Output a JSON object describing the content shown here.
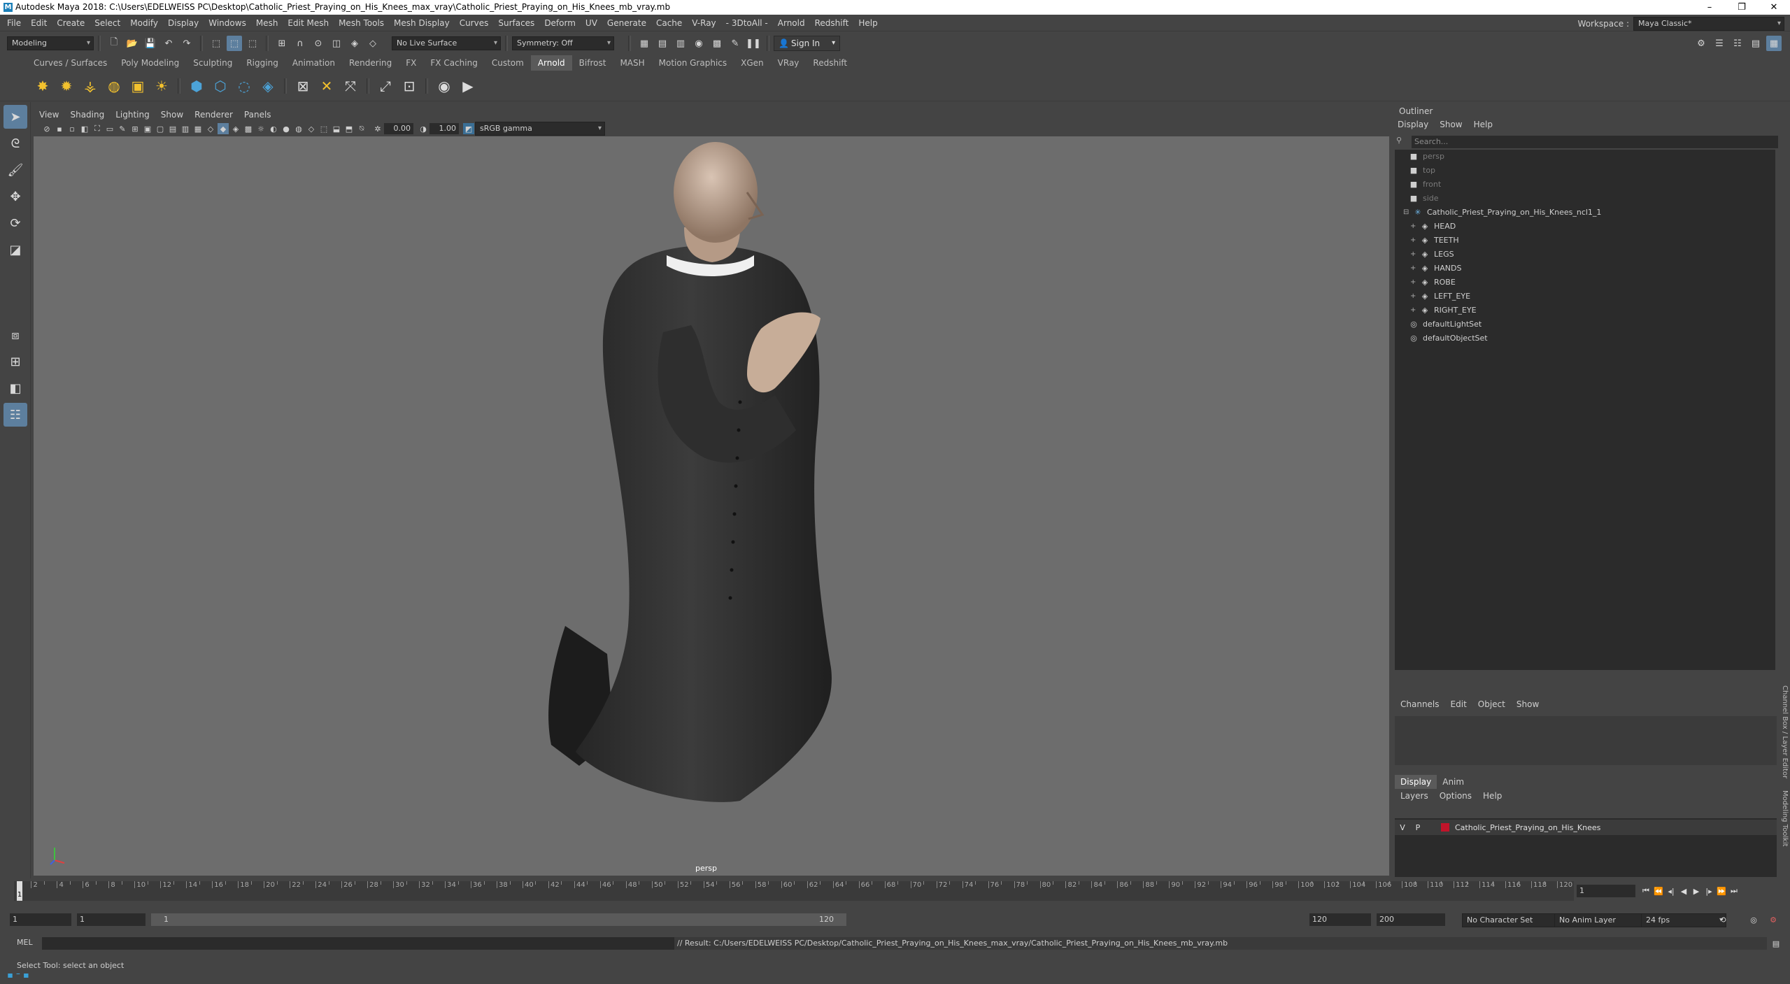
{
  "window": {
    "title": "Autodesk Maya 2018: C:\\Users\\EDELWEISS PC\\Desktop\\Catholic_Priest_Praying_on_His_Knees_max_vray\\Catholic_Priest_Praying_on_His_Knees_mb_vray.mb",
    "minimize": "–",
    "maximize": "❐",
    "close": "✕"
  },
  "menubar": {
    "items": [
      "File",
      "Edit",
      "Create",
      "Select",
      "Modify",
      "Display",
      "Windows",
      "Mesh",
      "Edit Mesh",
      "Mesh Tools",
      "Mesh Display",
      "Curves",
      "Surfaces",
      "Deform",
      "UV",
      "Generate",
      "Cache",
      "V-Ray",
      "- 3DtoAll -",
      "Arnold",
      "Redshift",
      "Help"
    ],
    "workspace_label": "Workspace :",
    "workspace_value": "Maya Classic*"
  },
  "statusline": {
    "mode": "Modeling",
    "live_surface": "No Live Surface",
    "symmetry": "Symmetry: Off",
    "signin": "Sign In"
  },
  "shelf": {
    "tabs": [
      "Curves / Surfaces",
      "Poly Modeling",
      "Sculpting",
      "Rigging",
      "Animation",
      "Rendering",
      "FX",
      "FX Caching",
      "Custom",
      "Arnold",
      "Bifrost",
      "MASH",
      "Motion Graphics",
      "XGen",
      "VRay",
      "Redshift"
    ],
    "active_tab": "Arnold"
  },
  "viewport": {
    "menus": [
      "View",
      "Shading",
      "Lighting",
      "Show",
      "Renderer",
      "Panels"
    ],
    "exposure": "0.00",
    "gamma": "1.00",
    "colorspace": "sRGB gamma",
    "camera": "persp"
  },
  "outliner": {
    "title": "Outliner",
    "menus": [
      "Display",
      "Show",
      "Help"
    ],
    "search_placeholder": "Search...",
    "items": [
      {
        "label": "persp",
        "dim": true,
        "indent": 1,
        "icon": "camera-icon"
      },
      {
        "label": "top",
        "dim": true,
        "indent": 1,
        "icon": "camera-icon"
      },
      {
        "label": "front",
        "dim": true,
        "indent": 1,
        "icon": "camera-icon"
      },
      {
        "label": "side",
        "dim": true,
        "indent": 1,
        "icon": "camera-icon"
      },
      {
        "label": "Catholic_Priest_Praying_on_His_Knees_ncl1_1",
        "dim": false,
        "indent": 0,
        "icon": "group-icon"
      },
      {
        "label": "HEAD",
        "dim": false,
        "indent": 2,
        "icon": "mesh-icon"
      },
      {
        "label": "TEETH",
        "dim": false,
        "indent": 2,
        "icon": "mesh-icon"
      },
      {
        "label": "LEGS",
        "dim": false,
        "indent": 2,
        "icon": "mesh-icon"
      },
      {
        "label": "HANDS",
        "dim": false,
        "indent": 2,
        "icon": "mesh-icon"
      },
      {
        "label": "ROBE",
        "dim": false,
        "indent": 2,
        "icon": "mesh-icon"
      },
      {
        "label": "LEFT_EYE",
        "dim": false,
        "indent": 2,
        "icon": "mesh-icon"
      },
      {
        "label": "RIGHT_EYE",
        "dim": false,
        "indent": 2,
        "icon": "mesh-icon"
      },
      {
        "label": "defaultLightSet",
        "dim": false,
        "indent": 1,
        "icon": "set-icon"
      },
      {
        "label": "defaultObjectSet",
        "dim": false,
        "indent": 1,
        "icon": "set-icon"
      }
    ]
  },
  "channelbox": {
    "tabs": [
      "Channels",
      "Edit",
      "Object",
      "Show"
    ]
  },
  "layereditor": {
    "tabs": [
      "Display",
      "Anim"
    ],
    "menus": [
      "Layers",
      "Options",
      "Help"
    ],
    "layer": {
      "v": "V",
      "p": "P",
      "name": "Catholic_Priest_Praying_on_His_Knees",
      "color": "#c0142a"
    }
  },
  "sidetabs": [
    "Channel Box / Layer Editor",
    "Modeling Toolkit"
  ],
  "timeslider": {
    "ticks": [
      "2",
      "4",
      "6",
      "8",
      "10",
      "12",
      "14",
      "16",
      "18",
      "20",
      "22",
      "24",
      "26",
      "28",
      "30",
      "32",
      "34",
      "36",
      "38",
      "40",
      "42",
      "44",
      "46",
      "48",
      "50",
      "52",
      "54",
      "56",
      "58",
      "60",
      "62",
      "64",
      "66",
      "68",
      "70",
      "72",
      "74",
      "76",
      "78",
      "80",
      "82",
      "84",
      "86",
      "88",
      "90",
      "92",
      "94",
      "96",
      "98",
      "100",
      "102",
      "104",
      "106",
      "108",
      "110",
      "112",
      "114",
      "116",
      "118",
      "120"
    ],
    "current_frame_marker": "1",
    "current_frame": "1"
  },
  "rangeslider": {
    "start": "1",
    "start2": "1",
    "range_start": "1",
    "range_end": "120",
    "end": "120",
    "anim_end": "200",
    "character_set": "No Character Set",
    "anim_layer": "No Anim Layer",
    "fps": "24 fps"
  },
  "cmdline": {
    "label": "MEL",
    "result": "// Result: C:/Users/EDELWEISS PC/Desktop/Catholic_Priest_Praying_on_His_Knees_max_vray/Catholic_Priest_Praying_on_His_Knees_mb_vray.mb"
  },
  "helpline": "Select Tool: select an object"
}
